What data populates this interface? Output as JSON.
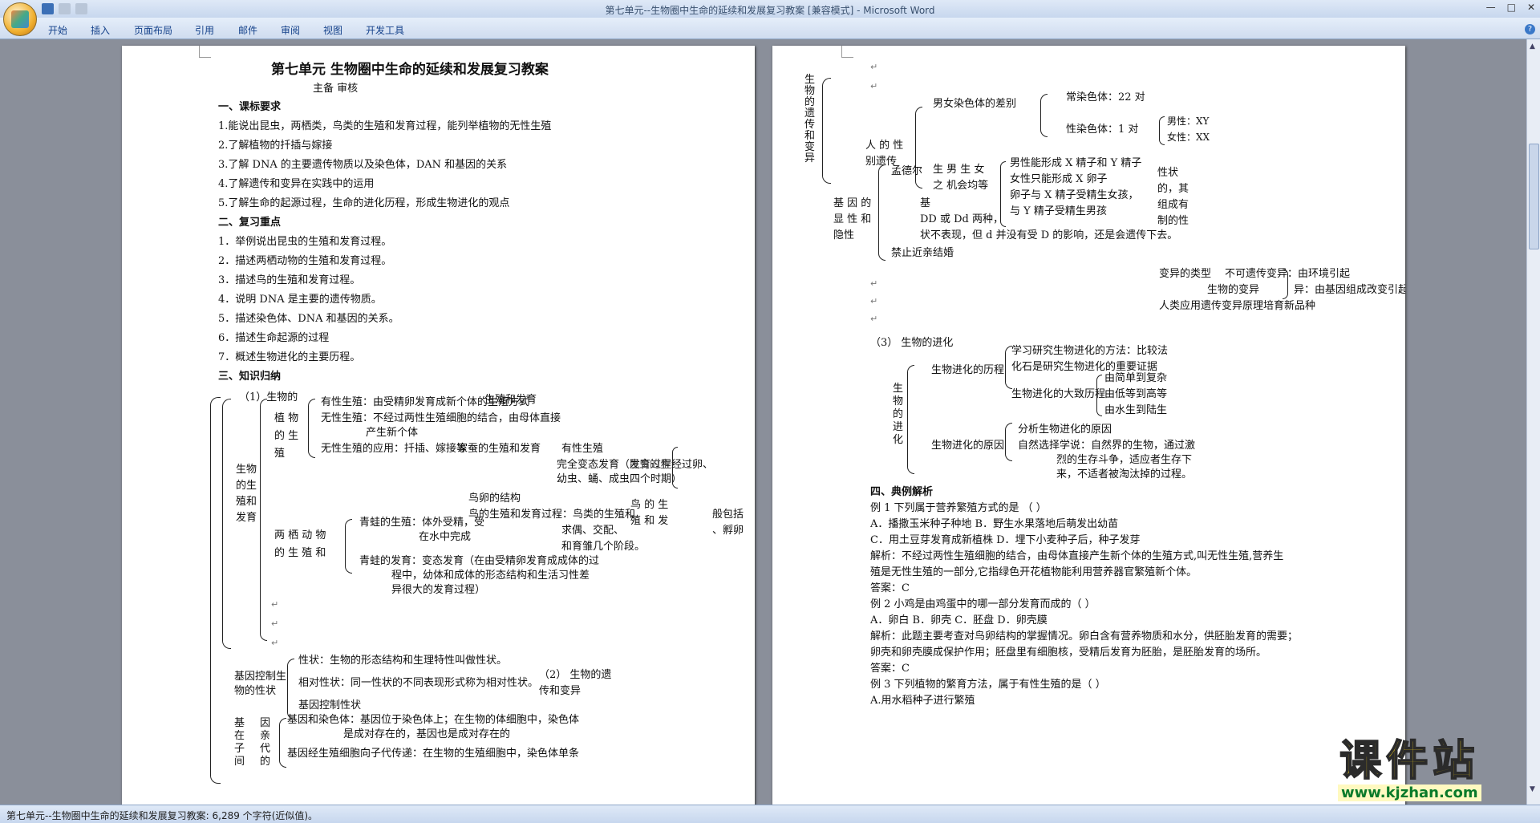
{
  "window": {
    "title": "第七单元--生物圈中生命的延续和发展复习教案 [兼容模式] - Microsoft Word",
    "ribbon_tabs": [
      "开始",
      "插入",
      "页面布局",
      "引用",
      "邮件",
      "审阅",
      "视图",
      "开发工具"
    ],
    "colors": {
      "ribbon": "#cfdcef",
      "workspace": "#8a8f9a",
      "tab_text": "#15428b"
    },
    "icons": [
      "office-button-icon",
      "save-icon",
      "undo-icon",
      "redo-icon",
      "minimize-icon",
      "maximize-icon",
      "close-icon",
      "help-icon"
    ]
  },
  "status": {
    "text": "第七单元--生物圈中生命的延续和发展复习教案: 6,289 个字符(近似值)。"
  },
  "watermark": {
    "line1": "课件站",
    "line2": "www.kjzhan.com"
  },
  "page1": {
    "title": "第七单元    生物圈中生命的延续和发展复习教案",
    "byline": "主备        审核",
    "sec1": {
      "head": "一、课标要求",
      "items": [
        "1.能说出昆虫，两栖类，鸟类的生殖和发育过程，能列举植物的无性生殖",
        "2.了解植物的扦插与嫁接",
        "3.了解 DNA 的主要遗传物质以及染色体，DAN    和基因的关系",
        "4.了解遗传和变异在实践中的运用",
        "5.了解生命的起源过程，生命的进化历程，形成生物进化的观点"
      ]
    },
    "sec2": {
      "head": "二、复习重点",
      "items": [
        "1．举例说出昆虫的生殖和发育过程。",
        "2．描述两栖动物的生殖和发育过程。",
        "3．描述鸟的生殖和发育过程。",
        "4．说明 DNA 是主要的遗传物质。",
        "5．描述染色体、DNA 和基因的关系。",
        "6．描述生命起源的过程",
        "7．概述生物进化的主要历程。"
      ]
    },
    "sec3": {
      "head": "三、知识归纳"
    },
    "map": {
      "n1": "（1）生物的",
      "n_repro": [
        "生物",
        "的生",
        "殖和",
        "发育"
      ],
      "n_plant": [
        "植    物",
        "的    生",
        "殖"
      ],
      "sexual": "有性生殖：由受精卵发育成新个体的生殖方式",
      "asexual1": "无性生殖：不经过两性生殖细胞的结合，由母体直接",
      "asexual2": "产生新个体",
      "asexual_use": "无性生殖的应用：扦插、嫁接等",
      "silk": "家蚕的生殖和发育",
      "repro_dev": "生殖和发育",
      "sexual2": "有性生殖",
      "complete": "完全变态发育（发育过程经过卵、",
      "complete2": "幼虫、蛹、成虫四个时期）",
      "insect_frag": "昆虫的生",
      "egg_struct": "鸟卵的结构",
      "bird_dev": "鸟的生殖和发育过程：鸟类的生殖和",
      "bird_dev2": "求偶、交配、",
      "bird_dev3": "和育雏几个阶段。",
      "bird_side": [
        "鸟    的    生",
        "殖    和    发"
      ],
      "bird_side2": [
        "般包括",
        "、孵卵"
      ],
      "amphibian": [
        "两    栖    动    物",
        "的    生    殖    和"
      ],
      "frog1": "青蛙的生殖：体外受精，受",
      "frog1b": "在水中完成",
      "frog2": "青蛙的发育：变态发育（在由受精卵发育成成体的过",
      "frog2b": "程中，幼体和成体的形态结构和生活习性差",
      "frog2c": "异很大的发育过程）",
      "gene_ctrl": [
        "基因控制生",
        "物的性状"
      ],
      "trait": "性状：生物的形态结构和生理特性叫做性状。",
      "rel_trait": "相对性状：同一性状的不同表现形式称为相对性状。",
      "gene_ctrl2": "基因控制性状",
      "n2": [
        "（2）  生物的遗",
        "传和变异"
      ],
      "gene_chrom": "基因和染色体：基因位于染色体上；在生物的体细胞中，染色体",
      "gene_chrom2": "是成对存在的，基因也是成对存在的",
      "gene_pass": "基因经生殖细胞向子代传递：在生物的生殖细胞中，染色体单条",
      "bottom_vert": [
        "基",
        "在",
        "子",
        "间"
      ],
      "bottom_vert2": [
        "因",
        "亲",
        "代",
        "的"
      ]
    }
  },
  "page2": {
    "vert_heredity": "生物的遗传和变异",
    "human_sex": [
      "人  的  性",
      "别遗传"
    ],
    "sex_diff": "男女染色体的差别",
    "normal": "常染色体：22 对",
    "sexchrom": "性染色体：1 对",
    "male": "男性：XY",
    "female": "女性：XX",
    "male_sperm": "男性能形成 X 精子和 Y 精子",
    "female_egg": "女性只能形成 X 卵子",
    "combine1": "卵子与 X 精子受精生女孩，",
    "combine2": "与 Y 精子受精生男孩",
    "chance": [
      "生 男 生 女",
      "之  机会均等"
    ],
    "mendel": "孟德尔",
    "gene_dom": [
      "基 因 的",
      "显 性 和",
      "隐性"
    ],
    "dd1": "基",
    "dd2": "DD 或 Dd 两种，",
    "dd3": "状不表现，但 d 并没有受 D 的影响，还是会遗传下去。",
    "ban": "禁止近亲结婚",
    "right_frag": [
      "性状",
      "的，其",
      "组成有",
      "制的性"
    ],
    "variation_type": "变异的类型",
    "non_heritable": "不可遗传变异：由环境引起",
    "bio_var": "生物的变异",
    "heritable": "异：由基因组成改变引起",
    "breeding": "人类应用遗传变异原理培育新品种",
    "evol_head": "（3）  生物的进化",
    "vert_evol": "生物的进化",
    "process": "生物进化的历程",
    "method": "学习研究生物进化的方法：比较法",
    "fossil": "化石是研究生物进化的重要证据",
    "trend": "生物进化的大致历程",
    "t1": "由简单到复杂",
    "t2": "由低等到高等",
    "t3": "由水生到陆生",
    "cause": "生物进化的原因",
    "c1": "分析生物进化的原因",
    "c2": "自然选择学说：自然界的生物，通过激",
    "c3": "烈的生存斗争，适应者生存下",
    "c4": "来，不适者被淘汰掉的过程。",
    "sec4": "四、典例解析",
    "lines": [
      "例 1 下列属于营养繁殖方式的是     （    ）",
      "A．播撒玉米种子种地              B．野生水果落地后萌发出幼苗",
      "C．用土豆芽发育成新植株        D．埋下小麦种子后，种子发芽",
      "解析：不经过两性生殖细胞的结合，由母体直接产生新个体的生殖方式,叫无性生殖,营养生",
      "殖是无性生殖的一部分,它指绿色开花植物能利用营养器官繁殖新个体。",
      "答案：C",
      "例 2 小鸡是由鸡蛋中的哪一部分发育而成的（     ）",
      "A．卵白              B．卵壳              C．胚盘              D．卵壳膜",
      "解析：此题主要考查对鸟卵结构的掌握情况。卵白含有营养物质和水分，供胚胎发育的需要；",
      "卵壳和卵壳膜成保护作用；胚盘里有细胞核，受精后发育为胚胎，是胚胎发育的场所。",
      "答案：C",
      "例 3 下列植物的繁育方法，属于有性生殖的是（      ）",
      "A.用水稻种子进行繁殖"
    ]
  }
}
